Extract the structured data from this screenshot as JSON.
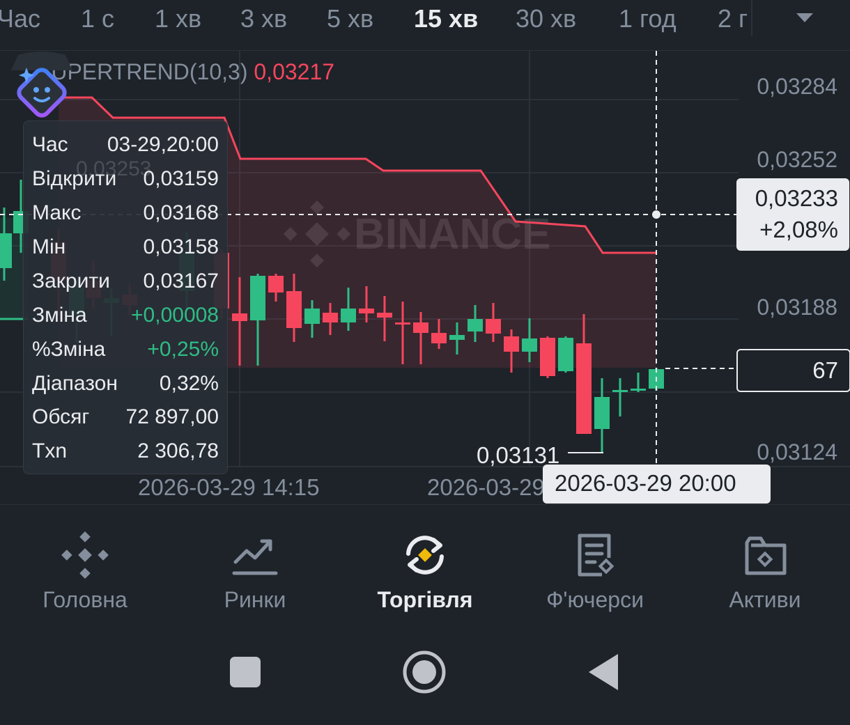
{
  "timeframes": {
    "items": [
      "Час",
      "1 с",
      "1 хв",
      "3 хв",
      "5 хв",
      "15 хв",
      "30 хв",
      "1 год",
      "2 г"
    ],
    "active_index": 5
  },
  "chart": {
    "indicator": {
      "name": "SUPERTREND(10,3)",
      "value": "0,03217"
    },
    "watermark": "BINANCE",
    "price_labels": [
      "0,03284",
      "0,03252",
      "0,03188",
      "0,03124"
    ],
    "faded_label": "0,03253",
    "date_labels": [
      "2026-03-29 14:15",
      "2026-03-29"
    ],
    "crosshair_price": "0,03233",
    "crosshair_change": "+2,08%",
    "last_price_partial": "67",
    "min_label": "0,03131",
    "crosshair_date": "2026-03-29 20:00",
    "colors": {
      "up": "#2ebd85",
      "down": "#f6465d",
      "background": "#1e2329"
    }
  },
  "info_panel": [
    {
      "key": "Час",
      "value": "03-29,20:00",
      "tone": "neutral"
    },
    {
      "key": "Відкрити",
      "value": "0,03159",
      "tone": "neutral"
    },
    {
      "key": "Макс",
      "value": "0,03168",
      "tone": "neutral"
    },
    {
      "key": "Мін",
      "value": "0,03158",
      "tone": "neutral"
    },
    {
      "key": "Закрити",
      "value": "0,03167",
      "tone": "neutral"
    },
    {
      "key": "Зміна",
      "value": "+0,00008",
      "tone": "green"
    },
    {
      "key": "%Зміна",
      "value": "+0,25%",
      "tone": "green"
    },
    {
      "key": "Діапазон",
      "value": "0,32%",
      "tone": "neutral"
    },
    {
      "key": "Обсяг",
      "value": "72 897,00",
      "tone": "neutral"
    },
    {
      "key": "Txn",
      "value": "2 306,78",
      "tone": "neutral"
    }
  ],
  "bottom_nav": {
    "items": [
      {
        "label": "Головна",
        "icon": "binance-logo-icon"
      },
      {
        "label": "Ринки",
        "icon": "markets-chart-icon"
      },
      {
        "label": "Торгівля",
        "icon": "trade-swap-icon"
      },
      {
        "label": "Ф'ючерси",
        "icon": "futures-document-icon"
      },
      {
        "label": "Активи",
        "icon": "wallet-icon"
      }
    ],
    "active_index": 2
  },
  "system_nav": [
    "recents-square-icon",
    "home-circle-icon",
    "back-triangle-icon"
  ]
}
